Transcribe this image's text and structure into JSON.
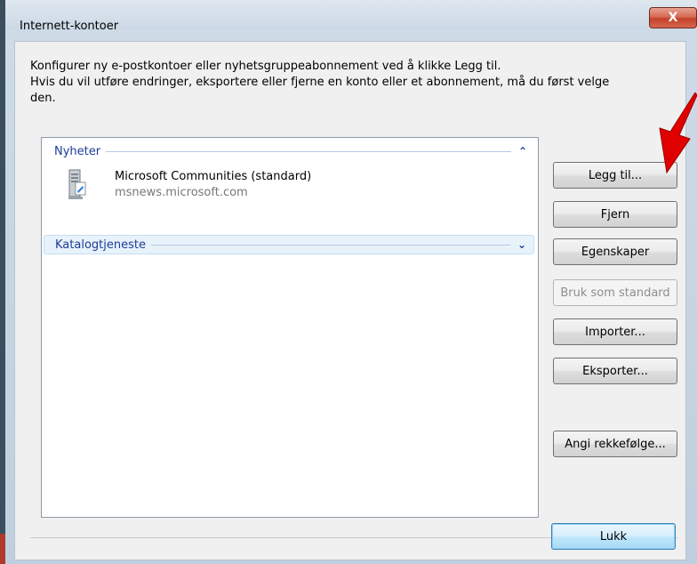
{
  "window": {
    "title": "Internett-kontoer",
    "close_symbol": "X"
  },
  "description": {
    "line1": "Konfigurer ny e-postkontoer eller nyhetsgruppeabonnement ved å klikke Legg til.",
    "line2": "Hvis du vil utføre endringer, eksportere eller fjerne en konto eller et abonnement, må du først velge",
    "line3": "den."
  },
  "list": {
    "groups": [
      {
        "label": "Nyheter",
        "chevron": "⌃",
        "expanded": true
      },
      {
        "label": "Katalogtjeneste",
        "chevron": "⌄",
        "expanded": false
      }
    ],
    "items": [
      {
        "name": "Microsoft Communities (standard)",
        "server": "msnews.microsoft.com",
        "icon": "news-server-icon"
      }
    ]
  },
  "buttons": {
    "add": "Legg til...",
    "remove": "Fjern",
    "properties": "Egenskaper",
    "set_default": "Bruk som standard",
    "import": "Importer...",
    "export": "Eksporter...",
    "set_order": "Angi rekkefølge...",
    "close": "Lukk"
  },
  "colors": {
    "accent": "#1e3c96",
    "close_button": "#c2412b",
    "annotation_arrow": "#e00000"
  }
}
